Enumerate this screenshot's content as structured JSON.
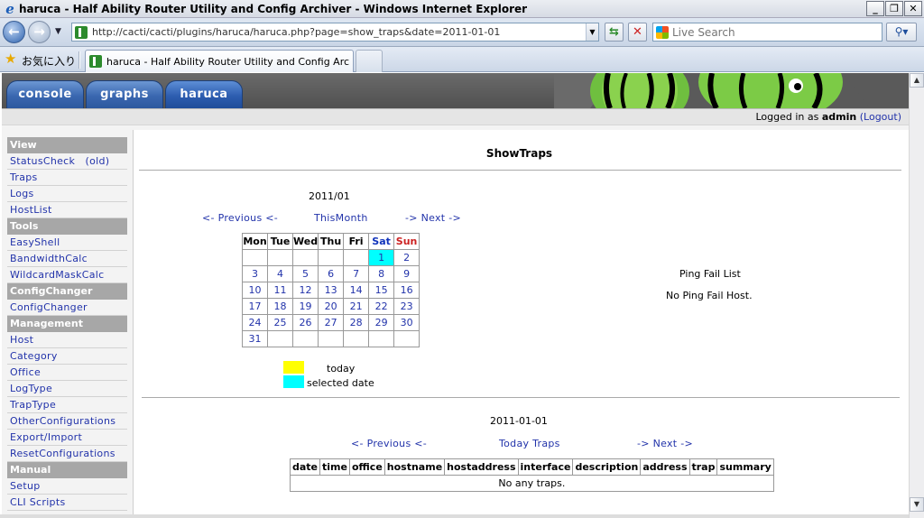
{
  "window": {
    "title": "haruca - Half Ability Router Utility and Config Archiver - Windows Internet Explorer"
  },
  "addressbar": {
    "url": "http://cacti/cacti/plugins/haruca/haruca.php?page=show_traps&date=2011-01-01",
    "search_placeholder": "Live Search"
  },
  "favorites": {
    "label": "お気に入り"
  },
  "browser_tab": {
    "label": "haruca - Half Ability Router Utility and Config Arc..."
  },
  "tabs": [
    {
      "label": "console"
    },
    {
      "label": "graphs"
    },
    {
      "label": "haruca"
    }
  ],
  "header": {
    "logged_in_prefix": "Logged in as",
    "user": "admin",
    "logout_open": "(",
    "logout_label": "Logout",
    "logout_close": ")"
  },
  "sidebar": {
    "sections": [
      {
        "title": "View",
        "items": [
          "StatusCheck　(old)",
          "Traps",
          "Logs",
          "HostList"
        ]
      },
      {
        "title": "Tools",
        "items": [
          "EasyShell",
          "BandwidthCalc",
          "WildcardMaskCalc"
        ]
      },
      {
        "title": "ConfigChanger",
        "items": [
          "ConfigChanger"
        ]
      },
      {
        "title": "Management",
        "items": [
          "Host",
          "Category",
          "Office",
          "LogType",
          "TrapType",
          "OtherConfigurations",
          "Export/Import",
          "ResetConfigurations"
        ]
      },
      {
        "title": "Manual",
        "items": [
          "Setup",
          "CLI Scripts"
        ]
      }
    ]
  },
  "main": {
    "page_title": "ShowTraps",
    "calendar": {
      "month": "2011/01",
      "prev": "<- Previous <-",
      "this_month": "ThisMonth",
      "next": "-> Next ->",
      "weekdays": [
        "Mon",
        "Tue",
        "Wed",
        "Thu",
        "Fri",
        "Sat",
        "Sun"
      ],
      "weeks": [
        [
          "",
          "",
          "",
          "",
          "",
          "1",
          "2"
        ],
        [
          "3",
          "4",
          "5",
          "6",
          "7",
          "8",
          "9"
        ],
        [
          "10",
          "11",
          "12",
          "13",
          "14",
          "15",
          "16"
        ],
        [
          "17",
          "18",
          "19",
          "20",
          "21",
          "22",
          "23"
        ],
        [
          "24",
          "25",
          "26",
          "27",
          "28",
          "29",
          "30"
        ],
        [
          "31",
          "",
          "",
          "",
          "",
          "",
          ""
        ]
      ],
      "selected_day": "1",
      "legend": [
        {
          "label": "today",
          "color": "#ffff00"
        },
        {
          "label": "selected date",
          "color": "#00ffff"
        }
      ]
    },
    "ping": {
      "title": "Ping Fail List",
      "message": "No Ping Fail Host."
    },
    "traps": {
      "date": "2011-01-01",
      "prev": "<- Previous <-",
      "today": "Today Traps",
      "next": "-> Next ->",
      "columns": [
        "date",
        "time",
        "office",
        "hostname",
        "hostaddress",
        "interface",
        "description",
        "address",
        "trap",
        "summary"
      ],
      "empty_message": "No any traps."
    }
  }
}
